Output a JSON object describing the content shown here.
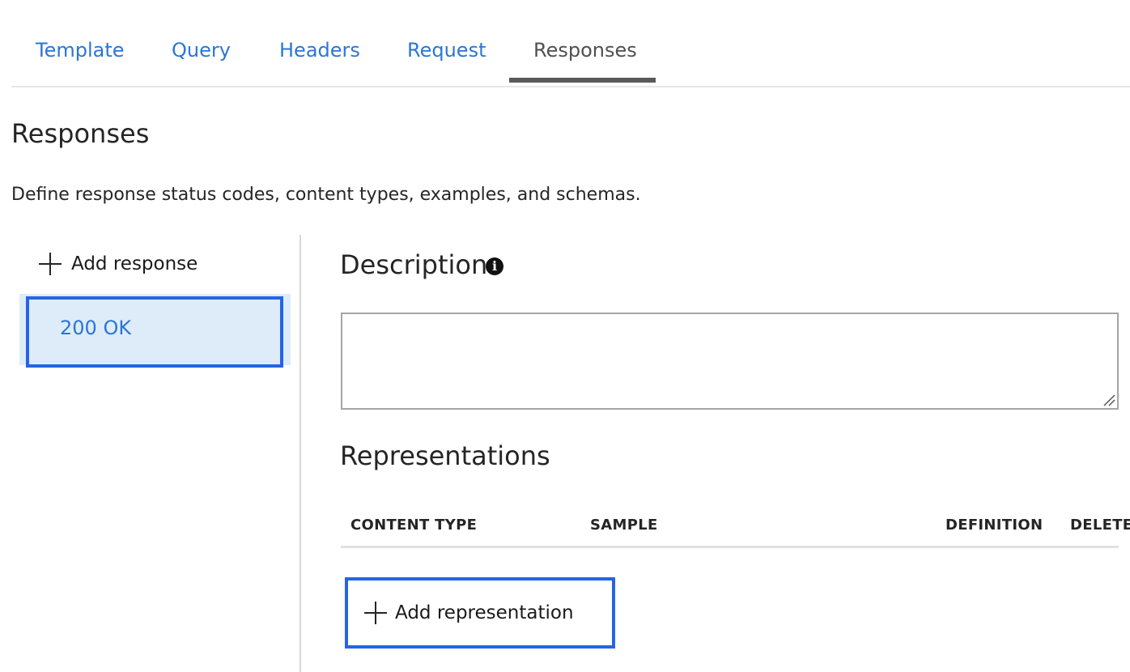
{
  "tabs": [
    {
      "label": "Template"
    },
    {
      "label": "Query"
    },
    {
      "label": "Headers"
    },
    {
      "label": "Request"
    },
    {
      "label": "Responses",
      "active": true
    }
  ],
  "page": {
    "title": "Responses",
    "description": "Define response status codes, content types, examples, and schemas."
  },
  "responses": {
    "add_label": "Add response",
    "items": [
      {
        "label": "200 OK",
        "selected": true
      }
    ]
  },
  "description_section": {
    "title": "Description",
    "icon": "info-icon",
    "value": ""
  },
  "representations": {
    "title": "Representations",
    "columns": [
      "CONTENT TYPE",
      "SAMPLE",
      "DEFINITION",
      "DELETE"
    ],
    "add_label": "Add representation"
  },
  "colors": {
    "link": "#2a76d6",
    "focus": "#2564e6",
    "selected_bg": "#deecf9",
    "active_tab_underline": "#595959"
  }
}
